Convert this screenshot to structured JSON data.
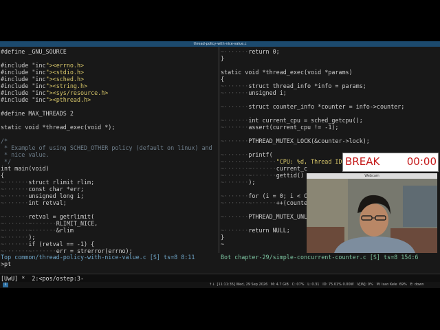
{
  "window": {
    "title": "thread-policy-with-nice-value.c"
  },
  "left_pane": {
    "lines": [
      "#define _GNU_SOURCE",
      "",
      "#include <errno.h>",
      "#include <stdio.h>",
      "#include <sched.h>",
      "#include <string.h>",
      "#include <sys/resource.h>",
      "#include <pthread.h>",
      "",
      "#define MAX_THREADS 2",
      "",
      "static void *thread_exec(void *);",
      "",
      "/*",
      " * Example of using SCHED_OTHER policy (default on linux) and",
      " * nice value.",
      " */",
      "int main(void)",
      "{",
      "~·······struct rlimit rlim;",
      "~·······const char *err;",
      "~·······unsigned long i;",
      "~·······int retval;",
      "",
      "~·······retval = getrlimit(",
      "~·······~·······RLIMIT_NICE,",
      "~·······~·······&rlim",
      "~·······);",
      "~·······if (retval == -1) {",
      "~·······~·······err = strerror(errno);"
    ],
    "status": "Top common/thread-policy-with-nice-value.c [S] ts=8 8:11",
    "cmdline": ">pt"
  },
  "right_pane": {
    "lines": [
      "~·······return 0;",
      "}",
      "",
      "static void *thread_exec(void *params)",
      "{",
      "~·······struct thread_info *info = params;",
      "~·······unsigned i;",
      "",
      "~·······struct counter_info *counter = info->counter;",
      "",
      "~·······int current_cpu = sched_getcpu();",
      "~·······assert(current_cpu != -1);",
      "",
      "~·······PTHREAD_MUTEX_LOCK(&counter->lock);",
      "",
      "~·······printf(",
      "~·······~·······\"CPU: %d, Thread ID:",
      "~·······~·······current_c",
      "~·······~·······gettid()",
      "~·······);",
      "",
      "~·······for (i = 0; i < C",
      "~·······~·······++(counte",
      "",
      "~·······PTHREAD_MUTEX_UNL",
      "",
      "~·······return NULL;",
      "}",
      "~"
    ],
    "status": "Bot chapter-29/simple-concurrent-counter.c [S] ts=8 154:6"
  },
  "tmux": {
    "status": "[UwU] *  2:<pos/ostep:3-"
  },
  "taskbar": {
    "workspace": "1",
    "sysinfo": "↑↓  [11:11:35] Wed, 29 Sep 2026   M: 4.7 GiB   C: 07%   L: 0.31   ID: 75.01% 0.00W   V[W]: 0%   M: isan Kele  69%   E: down"
  },
  "timer": {
    "label": "BREAK",
    "time": "00:00"
  },
  "webcam": {
    "title": "Webcam"
  },
  "colors": {
    "title_bar": "#1c4a6e",
    "include": "#e9a052",
    "comment": "#6f7f8c",
    "string": "#d9c86a",
    "timer_text": "#c41919"
  }
}
